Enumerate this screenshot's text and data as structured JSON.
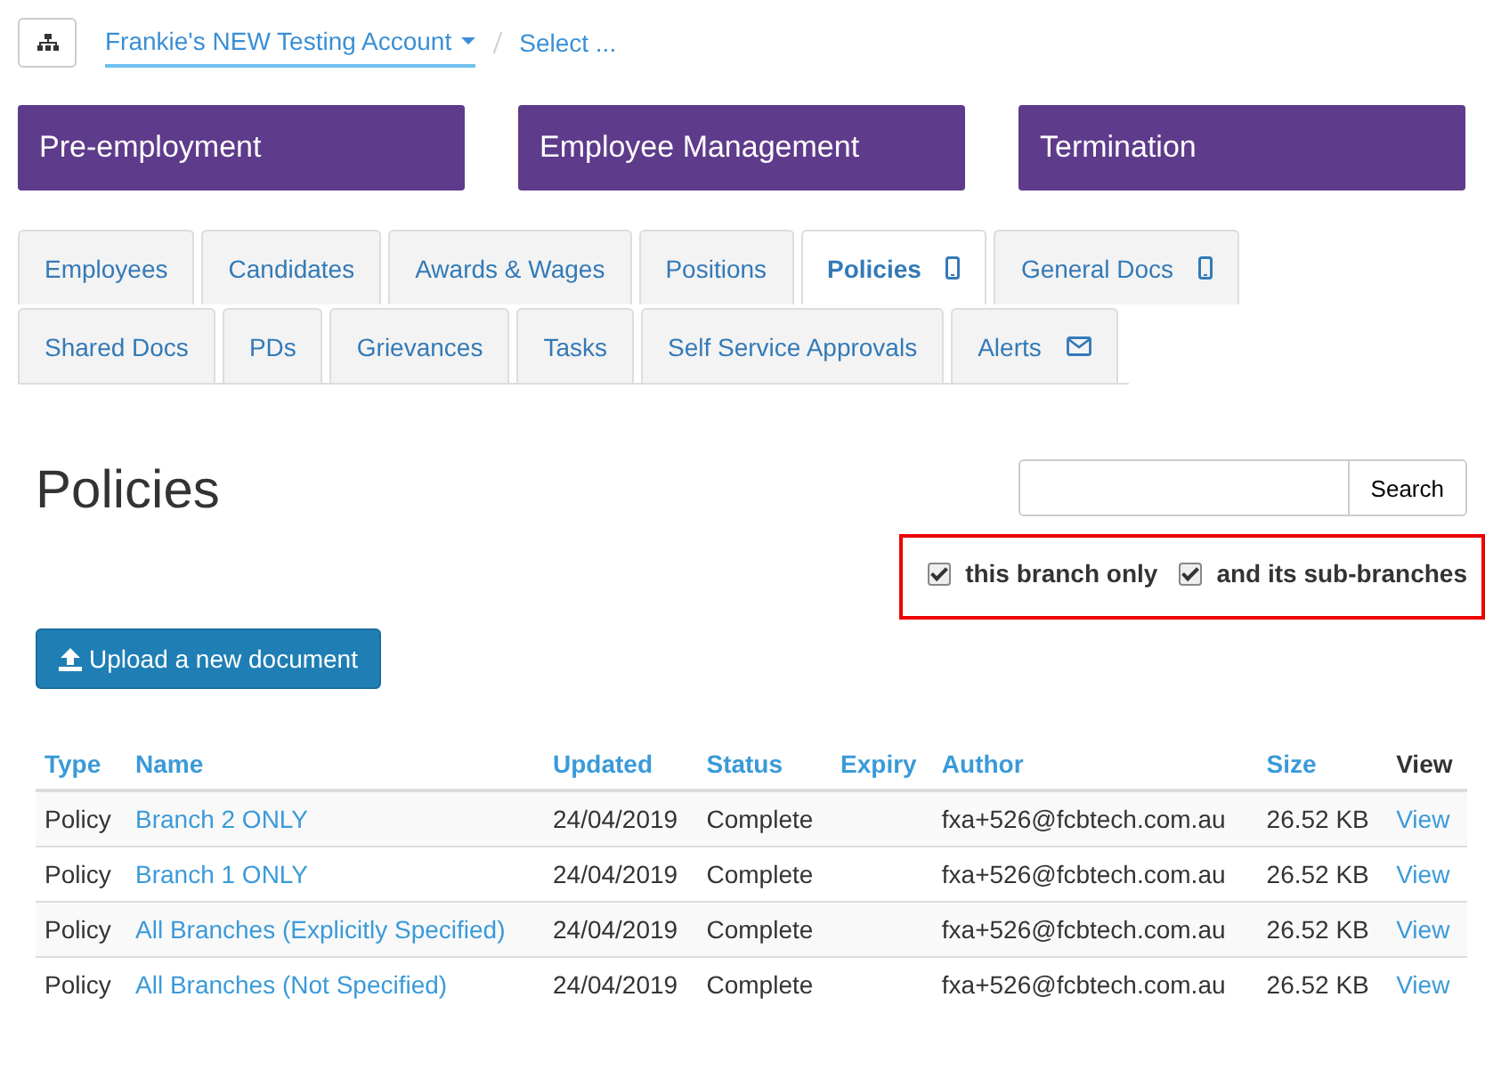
{
  "breadcrumb": {
    "account": "Frankie's NEW Testing Account",
    "select": "Select ..."
  },
  "sections": [
    {
      "label": "Pre-employment"
    },
    {
      "label": "Employee Management"
    },
    {
      "label": "Termination"
    }
  ],
  "tabs": [
    [
      {
        "label": "Employees",
        "selected": false
      },
      {
        "label": "Candidates",
        "selected": false
      },
      {
        "label": "Awards & Wages",
        "selected": false
      },
      {
        "label": "Positions",
        "selected": false
      },
      {
        "label": "Policies",
        "selected": true,
        "kind": "phone"
      },
      {
        "label": "General Docs",
        "selected": false,
        "kind": "phone"
      }
    ],
    [
      {
        "label": "Shared Docs",
        "selected": false
      },
      {
        "label": "PDs",
        "selected": false
      },
      {
        "label": "Grievances",
        "selected": false
      },
      {
        "label": "Tasks",
        "selected": false
      },
      {
        "label": "Self Service Approvals",
        "selected": false
      },
      {
        "label": "Alerts",
        "selected": false,
        "kind": "mail"
      }
    ]
  ],
  "page_title": "Policies",
  "search": {
    "button": "Search"
  },
  "filters": {
    "highlighted": true,
    "items": [
      {
        "label": "this branch only",
        "checked": true
      },
      {
        "label": "and its sub-branches",
        "checked": true
      }
    ]
  },
  "upload_button": "Upload a new document",
  "table": {
    "columns": [
      {
        "label": "Type",
        "sortable": true
      },
      {
        "label": "Name",
        "sortable": true
      },
      {
        "label": "Updated",
        "sortable": true
      },
      {
        "label": "Status",
        "sortable": true
      },
      {
        "label": "Expiry",
        "sortable": true
      },
      {
        "label": "Author",
        "sortable": true
      },
      {
        "label": "Size",
        "sortable": true
      },
      {
        "label": "View",
        "sortable": false
      }
    ],
    "rows": [
      [
        "Policy",
        "Branch 2 ONLY",
        "24/04/2019",
        "Complete",
        "",
        "fxa+526@fcbtech.com.au",
        "26.52 KB",
        "View"
      ],
      [
        "Policy",
        "Branch 1 ONLY",
        "24/04/2019",
        "Complete",
        "",
        "fxa+526@fcbtech.com.au",
        "26.52 KB",
        "View"
      ],
      [
        "Policy",
        "All Branches (Explicitly Specified)",
        "24/04/2019",
        "Complete",
        "",
        "fxa+526@fcbtech.com.au",
        "26.52 KB",
        "View"
      ],
      [
        "Policy",
        "All Branches (Not Specified)",
        "24/04/2019",
        "Complete",
        "",
        "fxa+526@fcbtech.com.au",
        "26.52 KB",
        "View"
      ]
    ]
  }
}
